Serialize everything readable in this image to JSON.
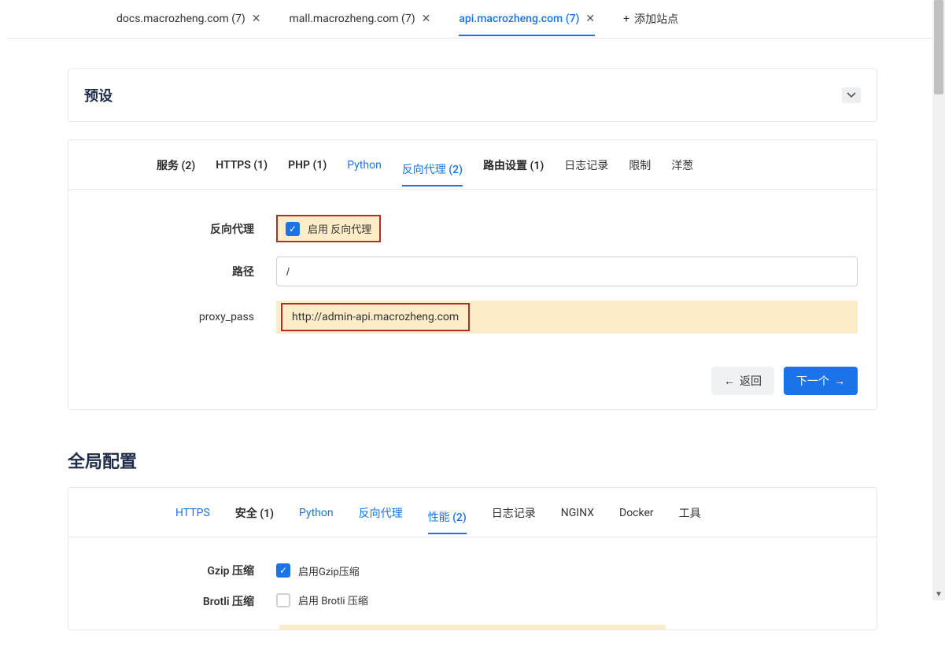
{
  "siteTabs": {
    "items": [
      {
        "label": "docs.macrozheng.com (7)"
      },
      {
        "label": "mall.macrozheng.com (7)"
      },
      {
        "label": "api.macrozheng.com (7)"
      }
    ],
    "addLabel": "添加站点"
  },
  "preset": {
    "title": "预设"
  },
  "configTabs": {
    "items": [
      {
        "label": "服务 (2)"
      },
      {
        "label": "HTTPS (1)"
      },
      {
        "label": "PHP (1)"
      },
      {
        "label": "Python"
      },
      {
        "label": "反向代理 (2)"
      },
      {
        "label": "路由设置 (1)"
      },
      {
        "label": "日志记录"
      },
      {
        "label": "限制"
      },
      {
        "label": "洋葱"
      }
    ]
  },
  "form": {
    "reverseProxyLabel": "反向代理",
    "enableReverseProxyLabel": "启用 反向代理",
    "pathLabel": "路径",
    "pathValue": "/",
    "proxyPassLabel": "proxy_pass",
    "proxyPassValue": "http://admin-api.macrozheng.com"
  },
  "actions": {
    "back": "返回",
    "next": "下一个"
  },
  "global": {
    "title": "全局配置",
    "tabs": [
      {
        "label": "HTTPS"
      },
      {
        "label": "安全 (1)"
      },
      {
        "label": "Python"
      },
      {
        "label": "反向代理"
      },
      {
        "label": "性能 (2)"
      },
      {
        "label": "日志记录"
      },
      {
        "label": "NGINX"
      },
      {
        "label": "Docker"
      },
      {
        "label": "工具"
      }
    ],
    "gzipLabel": "Gzip 压缩",
    "enableGzipLabel": "启用Gzip压缩",
    "brotliLabel": "Brotli 压缩",
    "enableBrotliLabel": "启用 Brotli 压缩"
  }
}
